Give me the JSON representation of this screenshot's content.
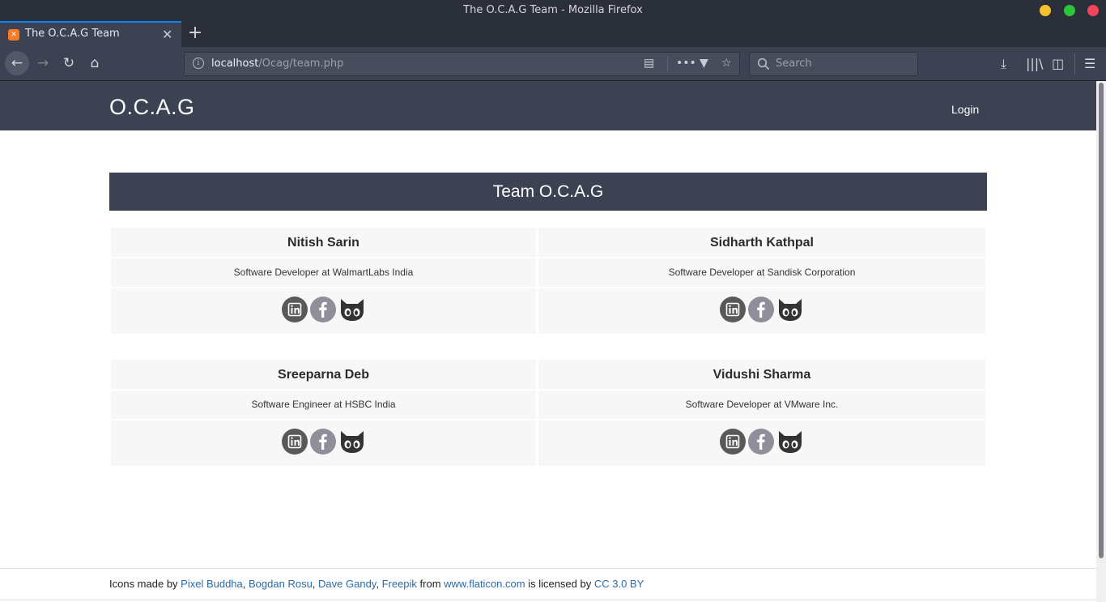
{
  "browser": {
    "window_title": "The O.C.A.G Team - Mozilla Firefox",
    "tab_title": "The O.C.A.G Team",
    "url_host": "localhost",
    "url_path": "/Ocag/team.php",
    "search_placeholder": "Search",
    "new_tab_glyph": "+",
    "close_tab_glyph": "✕"
  },
  "site": {
    "brand": "O.C.A.G",
    "login": "Login",
    "banner_title": "Team O.C.A.G"
  },
  "team": [
    {
      "name": "Nitish Sarin",
      "role": "Software Developer at WalmartLabs India"
    },
    {
      "name": "Sidharth Kathpal",
      "role": "Software Developer at Sandisk Corporation"
    },
    {
      "name": "Sreeparna Deb",
      "role": "Software Engineer at HSBC India"
    },
    {
      "name": "Vidushi Sharma",
      "role": "Software Developer at VMware Inc."
    }
  ],
  "footer": {
    "prefix": "Icons made by ",
    "author1": "Pixel Buddha",
    "sep1": ", ",
    "author2": "Bogdan Rosu",
    "sep2": ", ",
    "author3": "Dave Gandy",
    "sep3": ", ",
    "author4": "Freepik",
    "from": " from ",
    "site": "www.flaticon.com",
    "licensed": " is licensed by ",
    "license": "CC 3.0 BY"
  },
  "icons": {
    "linkedin": "linkedin-icon",
    "facebook": "facebook-icon",
    "github": "github-icon"
  },
  "colors": {
    "header_bg": "#3c4252",
    "card_bg": "#f7f7f7",
    "link": "#2a6aa8",
    "linkedin": "#595959",
    "facebook": "#8f8f9a"
  }
}
